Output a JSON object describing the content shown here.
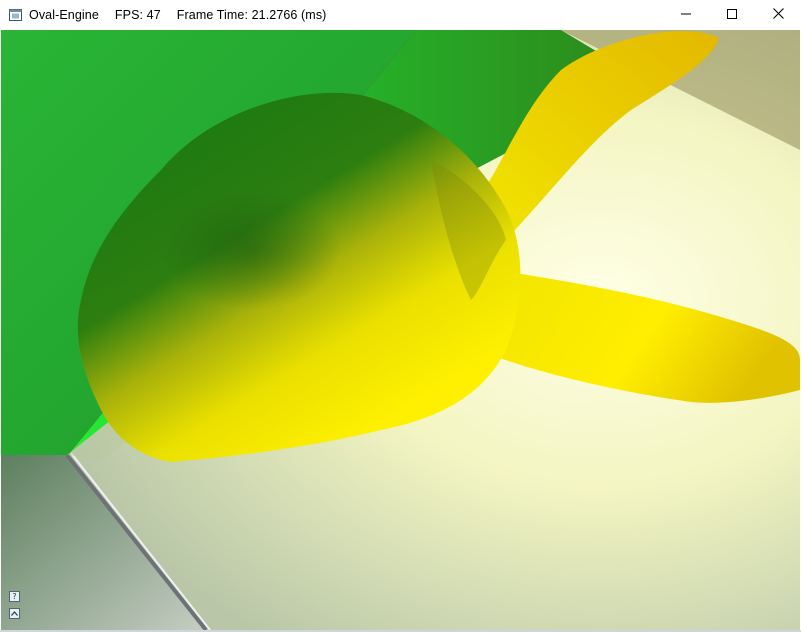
{
  "window": {
    "app_name": "Oval-Engine",
    "fps_label": "FPS: 47",
    "frame_time_label": "Frame Time: 21.2766 (ms)",
    "icon": "app-window-icon",
    "controls": {
      "minimize_icon": "minimize-icon",
      "maximize_icon": "maximize-icon",
      "close_icon": "close-icon"
    }
  },
  "scene": {
    "description_icon": "3d-render-viewport",
    "colors": {
      "green_wall": "#22c02e",
      "floor_white": "#ffffff",
      "model_yellow": "#ffee00",
      "model_shadow": "#2a7a10"
    }
  },
  "debug_buttons": [
    {
      "label": "?",
      "icon": "help-icon"
    },
    {
      "label": "^",
      "icon": "expand-up-icon"
    }
  ]
}
